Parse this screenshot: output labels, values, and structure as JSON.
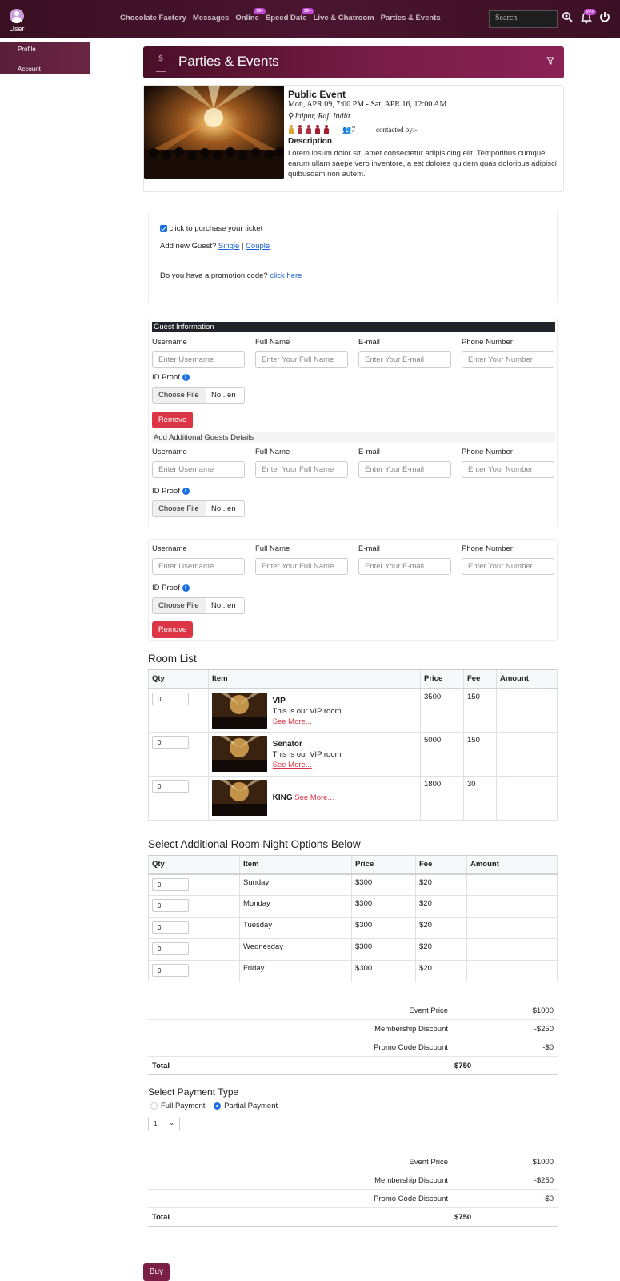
{
  "nav": {
    "user_label": "User",
    "links": [
      {
        "label": "Chocolate Factory",
        "badge": ""
      },
      {
        "label": "Messages",
        "badge": ""
      },
      {
        "label": "Online",
        "badge": "99+"
      },
      {
        "label": "Speed Date",
        "badge": "99+"
      },
      {
        "label": "Live & Chatroom",
        "badge": ""
      },
      {
        "label": "Parties & Events",
        "badge": ""
      }
    ],
    "search_placeholder": "Search",
    "bell_badge": "99+"
  },
  "sidebar": {
    "items": [
      "Profile",
      "Account"
    ]
  },
  "page": {
    "title": "Parties & Events",
    "logo_text": "$"
  },
  "event": {
    "title": "Public Event",
    "date": "Mon, APR 09, 7:00 PM - Sat, APR 16, 12:00 AM",
    "location": "Jaipur, Raj. India",
    "count": "7",
    "contact": "contacted by:-",
    "description_title": "Description",
    "description": "Lorem ipsum dolor sit, amet consectetur adipisicing elit. Temporibus cumque earum ullam saepe vero inventore, a est dolores quidem quas doloribus adipisci quibusdam non autem."
  },
  "ticket": {
    "purchase_label": "click to purchase your ticket",
    "add_guest_prefix": "Add new Guest?",
    "single": "Single",
    "separator": "|",
    "couple": "Couple",
    "promo_prefix": "Do you have a promotion code?",
    "promo_link": "click here"
  },
  "guest_form": {
    "header": "Guest Information",
    "additional_header": "Add Additional Guests Details",
    "labels": {
      "username": "Username",
      "full_name": "Full Name",
      "email": "E-mail",
      "phone": "Phone Number",
      "id_proof": "ID Proof"
    },
    "placeholders": {
      "username": "Enter Username",
      "full_name": "Enter Your Full Name",
      "email": "Enter Your E-mail",
      "phone": "Enter Your Number"
    },
    "choose_file": "Choose File",
    "file_name": "No...en",
    "remove": "Remove"
  },
  "rooms": {
    "title": "Room List",
    "headers": [
      "Qty",
      "Item",
      "Price",
      "Fee",
      "Amount"
    ],
    "rows": [
      {
        "qty": "0",
        "name": "VIP",
        "desc": "This is our VIP room",
        "see_more": "See More...",
        "price": "3500",
        "fee": "150",
        "amount": ""
      },
      {
        "qty": "0",
        "name": "Senator",
        "desc": "This is our VIP room",
        "see_more": "See More...",
        "price": "5000",
        "fee": "150",
        "amount": ""
      },
      {
        "qty": "0",
        "name": "KING",
        "desc": "",
        "see_more": "See More...",
        "price": "1800",
        "fee": "30",
        "amount": ""
      }
    ]
  },
  "nights": {
    "title": "Select Additional Room Night Options Below",
    "headers": [
      "Qty",
      "Item",
      "Price",
      "Fee",
      "Amount"
    ],
    "rows": [
      {
        "qty": "0",
        "item": "Sunday",
        "price": "$300",
        "fee": "$20",
        "amount": ""
      },
      {
        "qty": "0",
        "item": "Monday",
        "price": "$300",
        "fee": "$20",
        "amount": ""
      },
      {
        "qty": "0",
        "item": "Tuesday",
        "price": "$300",
        "fee": "$20",
        "amount": ""
      },
      {
        "qty": "0",
        "item": "Wednesday",
        "price": "$300",
        "fee": "$20",
        "amount": ""
      },
      {
        "qty": "0",
        "item": "Friday",
        "price": "$300",
        "fee": "$20",
        "amount": ""
      }
    ]
  },
  "summary1": {
    "event_price_label": "Event Price",
    "event_price": "$1000",
    "membership_label": "Membership Discount",
    "membership": "-$250",
    "promo_label": "Promo Code Discount",
    "promo": "-$0",
    "total_label": "Total",
    "total": "$750"
  },
  "payment": {
    "title": "Select Payment Type",
    "full": "Full Payment",
    "partial": "Partial Payment",
    "selected": "Partial Payment",
    "installments": "1"
  },
  "summary2": {
    "event_price_label": "Event Price",
    "event_price": "$1000",
    "membership_label": "Membership Discount",
    "membership": "-$250",
    "promo_label": "Promo Code Discount",
    "promo": "-$0",
    "total_label": "Total",
    "total": "$750"
  },
  "buy_label": "Buy",
  "colors": {
    "brand": "#7a1e48",
    "danger": "#dc3545",
    "link": "#1a5fd0",
    "check": "#1a6fe0"
  }
}
